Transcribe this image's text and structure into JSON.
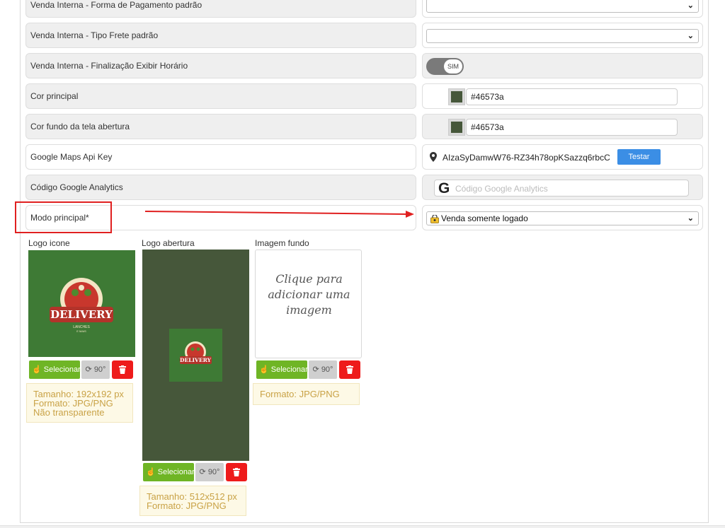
{
  "settings": {
    "rows": [
      {
        "label": "Venda Interna - Forma de Pagamento padrão",
        "value": ""
      },
      {
        "label": "Venda Interna - Tipo Frete padrão",
        "value": ""
      },
      {
        "label": "Venda Interna - Finalização Exibir Horário",
        "toggle": "SIM"
      },
      {
        "label": "Cor principal",
        "value": "#46573a"
      },
      {
        "label": "Cor fundo da tela abertura",
        "value": "#46573a"
      },
      {
        "label": "Google Maps Api Key",
        "value": "AIzaSyDamwW76-RZ34h78opKSazzq6rbcC",
        "button": "Testar"
      },
      {
        "label": "Código Google Analytics",
        "placeholder": "Código Google Analytics"
      },
      {
        "label": "Modo principal*",
        "value": "Venda somente logado"
      }
    ]
  },
  "colors": {
    "primary": "#46573a",
    "logo_bg": "#3e7a35",
    "select_btn": "#6fb525",
    "delete_btn": "#ee1b1b",
    "testar_btn": "#3b8ee5",
    "highlight": "#e02020"
  },
  "images": [
    {
      "label": "Logo icone",
      "select_label": "Selecionar",
      "rotate_label": "90°",
      "info": [
        "Tamanho: 192x192 px",
        "Formato: JPG/PNG",
        "Não transparente"
      ],
      "logo_text": "DELIVERY",
      "logo_subtext": "LANCHES",
      "logo_subtext2": "E MAIS"
    },
    {
      "label": "Logo abertura",
      "select_label": "Selecionar",
      "rotate_label": "90°",
      "info": [
        "Tamanho: 512x512 px",
        "Formato: JPG/PNG"
      ],
      "logo_text": "DELIVERY"
    },
    {
      "label": "Imagem fundo",
      "placeholder": "Clique para adicionar uma imagem",
      "select_label": "Selecionar",
      "rotate_label": "90°",
      "info": [
        "Formato: JPG/PNG"
      ]
    }
  ]
}
